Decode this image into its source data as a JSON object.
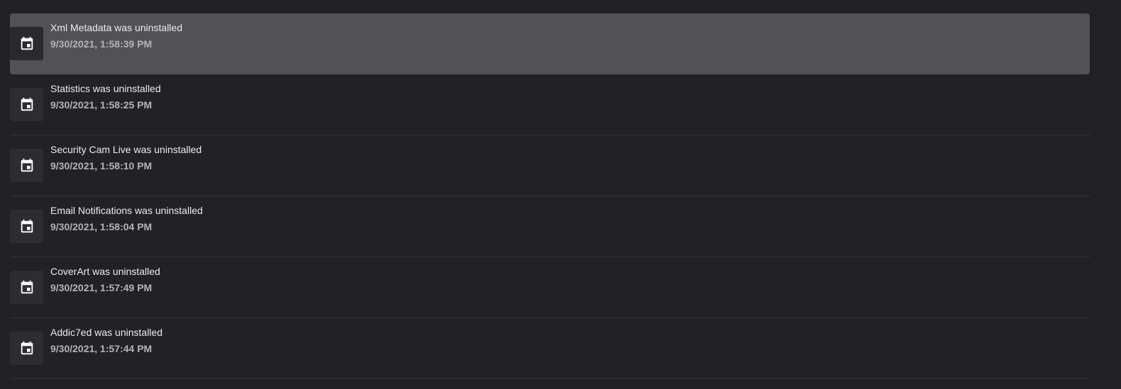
{
  "activity": {
    "items": [
      {
        "title": "Xml Metadata was uninstalled",
        "time": "9/30/2021, 1:58:39 PM",
        "icon": "event-icon",
        "selected": true
      },
      {
        "title": "Statistics was uninstalled",
        "time": "9/30/2021, 1:58:25 PM",
        "icon": "event-icon",
        "selected": false
      },
      {
        "title": "Security Cam Live was uninstalled",
        "time": "9/30/2021, 1:58:10 PM",
        "icon": "event-icon",
        "selected": false
      },
      {
        "title": "Email Notifications was uninstalled",
        "time": "9/30/2021, 1:58:04 PM",
        "icon": "event-icon",
        "selected": false
      },
      {
        "title": "CoverArt was uninstalled",
        "time": "9/30/2021, 1:57:49 PM",
        "icon": "event-icon",
        "selected": false
      },
      {
        "title": "Addic7ed was uninstalled",
        "time": "9/30/2021, 1:57:44 PM",
        "icon": "event-icon",
        "selected": false
      }
    ]
  },
  "colors": {
    "background": "#222124",
    "selected_row": "#525154",
    "icon_tile": "#2d2c30",
    "title_text": "#ececee",
    "time_text": "#b4b3b6",
    "divider": "#37363a"
  }
}
